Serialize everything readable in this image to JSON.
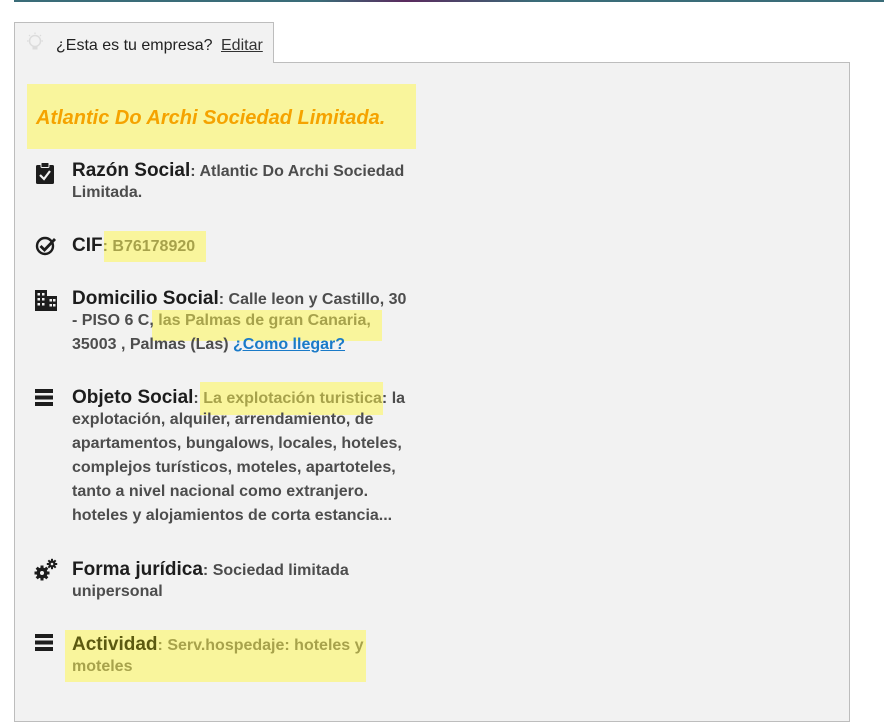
{
  "tab": {
    "question": "¿Esta es tu empresa?",
    "edit_label": "Editar"
  },
  "company": {
    "title": "Atlantic Do Archi Sociedad Limitada."
  },
  "razon": {
    "label": "Razón Social",
    "sep": ": ",
    "value_line1": "Atlantic Do Archi Sociedad",
    "value_line2": "Limitada."
  },
  "cif": {
    "label": "CIF",
    "sep": ": ",
    "value": "B76178920"
  },
  "domicilio": {
    "label": "Domicilio Social",
    "sep": ": ",
    "line1": "Calle leon y Castillo, 30",
    "line2_a": "- PISO 6 C, ",
    "line2_b": "las Palmas de gran Canaria,",
    "line3": "35003 , Palmas (Las)",
    "link": "¿Como llegar?"
  },
  "objeto": {
    "label": "Objeto Social",
    "sep": ": ",
    "highlight": "La explotación turistica",
    "line1_tail": ": la",
    "lines": [
      "explotación, alquiler, arrendamiento, de",
      "apartamentos, bungalows, locales, hoteles,",
      "complejos turísticos, moteles, apartoteles,",
      "tanto a nivel nacional como extranjero.",
      "hoteles y alojamientos de corta estancia..."
    ]
  },
  "forma": {
    "label": "Forma jurídica",
    "sep": ": ",
    "value_line1": "Sociedad limitada",
    "value_line2": "unipersonal"
  },
  "actividad": {
    "label": "Actividad",
    "sep": ": ",
    "value_line1": "Serv.hospedaje: hoteles y",
    "value_line2": "moteles"
  },
  "icons": {
    "bulb": "lightbulb-icon",
    "clipboard": "clipboard-check-icon",
    "check": "check-circle-icon",
    "building": "building-icon",
    "list": "list-icon",
    "gears": "gears-icon"
  },
  "colors": {
    "highlight": "#f9f59c",
    "title": "#f5a300",
    "link": "#1a7ac8"
  }
}
